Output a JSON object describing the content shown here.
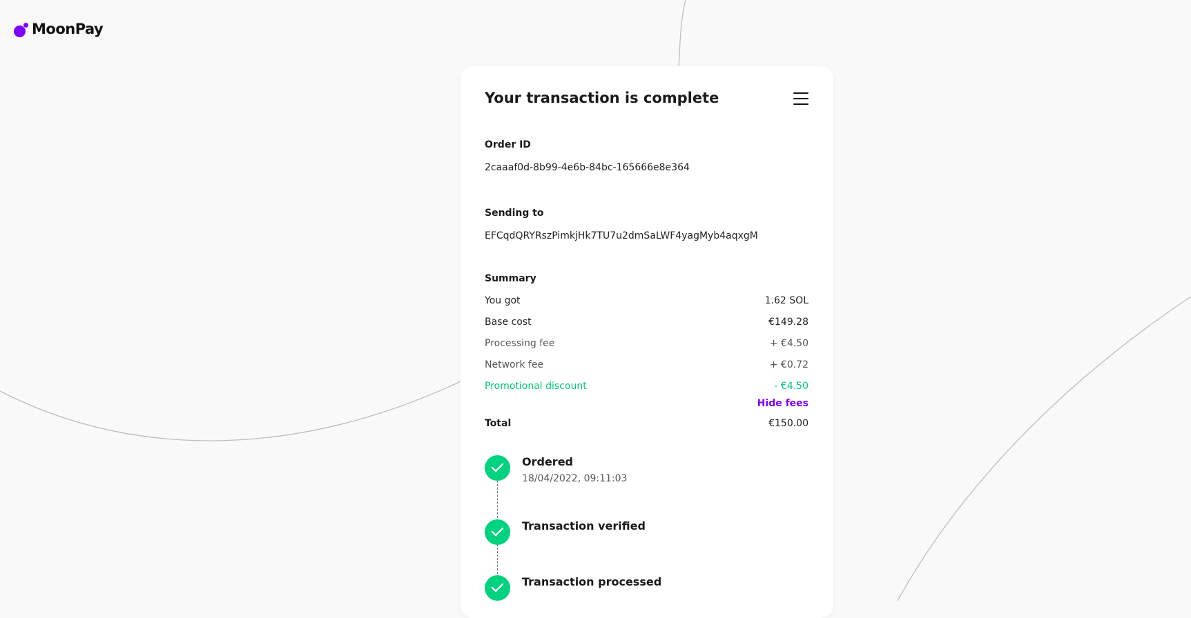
{
  "brand": {
    "name": "MoonPay",
    "accent_color": "#7d00ff",
    "success_color": "#00d27f"
  },
  "card": {
    "title": "Your transaction is complete",
    "menu_icon": "hamburger-menu-icon"
  },
  "order": {
    "label": "Order ID",
    "value": "2caaaf0d-8b99-4e6b-84bc-165666e8e364"
  },
  "sending": {
    "label": "Sending to",
    "value": "EFCqdQRYRszPimkjHk7TU7u2dmSaLWF4yagMyb4aqxgM"
  },
  "summary": {
    "label": "Summary",
    "rows": [
      {
        "label": "You got",
        "value": "1.62 SOL"
      },
      {
        "label": "Base cost",
        "value": "€149.28"
      },
      {
        "label": "Processing fee",
        "value": "+ €4.50"
      },
      {
        "label": "Network fee",
        "value": "+ €0.72"
      },
      {
        "label": "Promotional discount",
        "value": "- €4.50"
      }
    ],
    "hide_fees": "Hide fees",
    "total_label": "Total",
    "total_value": "€150.00"
  },
  "steps": [
    {
      "title": "Ordered",
      "subtitle": "18/04/2022, 09:11:03",
      "icon": "check-icon"
    },
    {
      "title": "Transaction verified",
      "icon": "check-icon"
    },
    {
      "title": "Transaction processed",
      "icon": "check-icon"
    }
  ]
}
